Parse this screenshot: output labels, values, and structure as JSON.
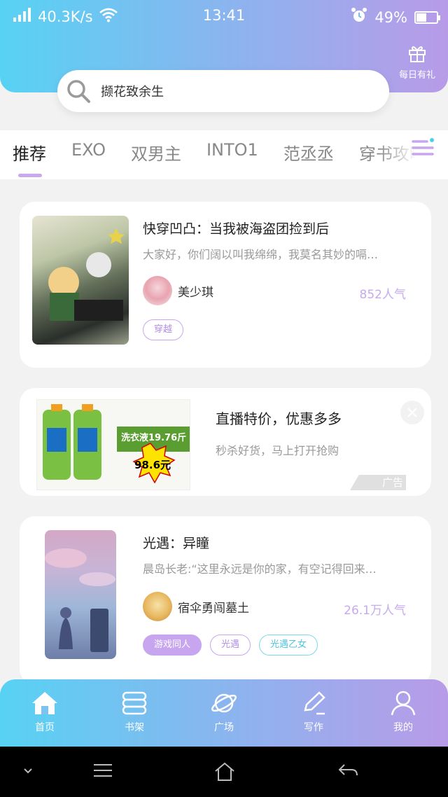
{
  "status_bar": {
    "speed": "40.3K/s",
    "time": "13:41",
    "battery": "49%",
    "battery_level": 0.49
  },
  "header": {
    "gift_label": "每日有礼"
  },
  "search": {
    "text": "撷花致余生"
  },
  "tabs": [
    "推荐",
    "EXO",
    "双男主",
    "INTO1",
    "范丞丞",
    "穿书攻略"
  ],
  "cards": [
    {
      "title": "快穿凹凸：当我被海盗团捡到后",
      "desc": "大家好，你们阔以叫我绵绵，我莫名其妙的嗝…",
      "author": "美少琪",
      "popularity": "852人气",
      "tags": [
        "穿越"
      ]
    },
    {
      "title": "光遇：异瞳",
      "desc": "晨岛长老:“这里永远是你的家，有空记得回来…",
      "author": "宿伞勇闯墓土",
      "popularity": "26.1万人气",
      "tags": [
        "游戏同人",
        "光遇",
        "光遇乙女"
      ]
    }
  ],
  "ad": {
    "title": "直播特价，优惠多多",
    "desc": "秒杀好货，马上打开抢购",
    "badge": "广告",
    "product": "洗衣液19.76斤",
    "price": "98.6元"
  },
  "bottom_nav": [
    {
      "label": "首页",
      "icon": "home-icon"
    },
    {
      "label": "书架",
      "icon": "bookshelf-icon"
    },
    {
      "label": "广场",
      "icon": "planet-icon"
    },
    {
      "label": "写作",
      "icon": "pen-icon"
    },
    {
      "label": "我的",
      "icon": "user-icon"
    }
  ],
  "colors": {
    "gradient_start": "#57d2f3",
    "gradient_end": "#b89be8",
    "accent": "#c6aaf0"
  }
}
